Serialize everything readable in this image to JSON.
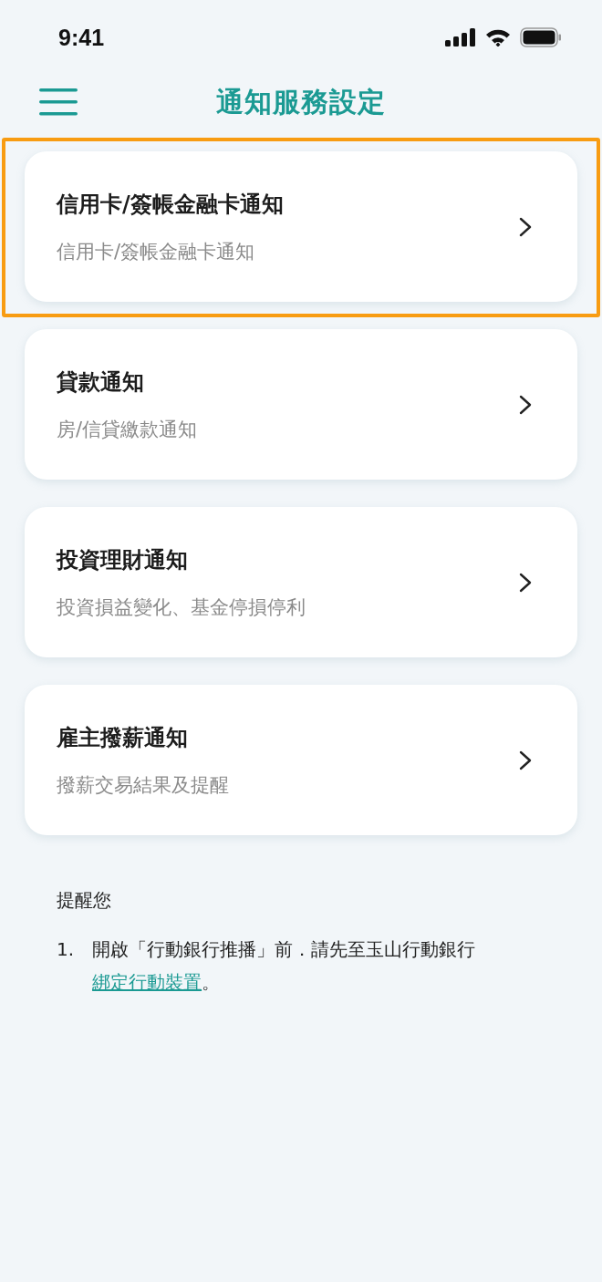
{
  "status_bar": {
    "time": "9:41"
  },
  "header": {
    "title": "通知服務設定"
  },
  "items": [
    {
      "title": "信用卡/簽帳金融卡通知",
      "subtitle": "信用卡/簽帳金融卡通知",
      "highlighted": true
    },
    {
      "title": "貸款通知",
      "subtitle": "房/信貸繳款通知",
      "highlighted": false
    },
    {
      "title": "投資理財通知",
      "subtitle": "投資損益變化、基金停損停利",
      "highlighted": false
    },
    {
      "title": "雇主撥薪通知",
      "subtitle": "撥薪交易結果及提醒",
      "highlighted": false
    }
  ],
  "notes": {
    "heading": "提醒您",
    "items": [
      {
        "number": "1.",
        "text": "開啟「行動銀行推播」前．請先至玉山行動銀行",
        "link": "綁定行動裝置",
        "after": "。"
      }
    ]
  }
}
